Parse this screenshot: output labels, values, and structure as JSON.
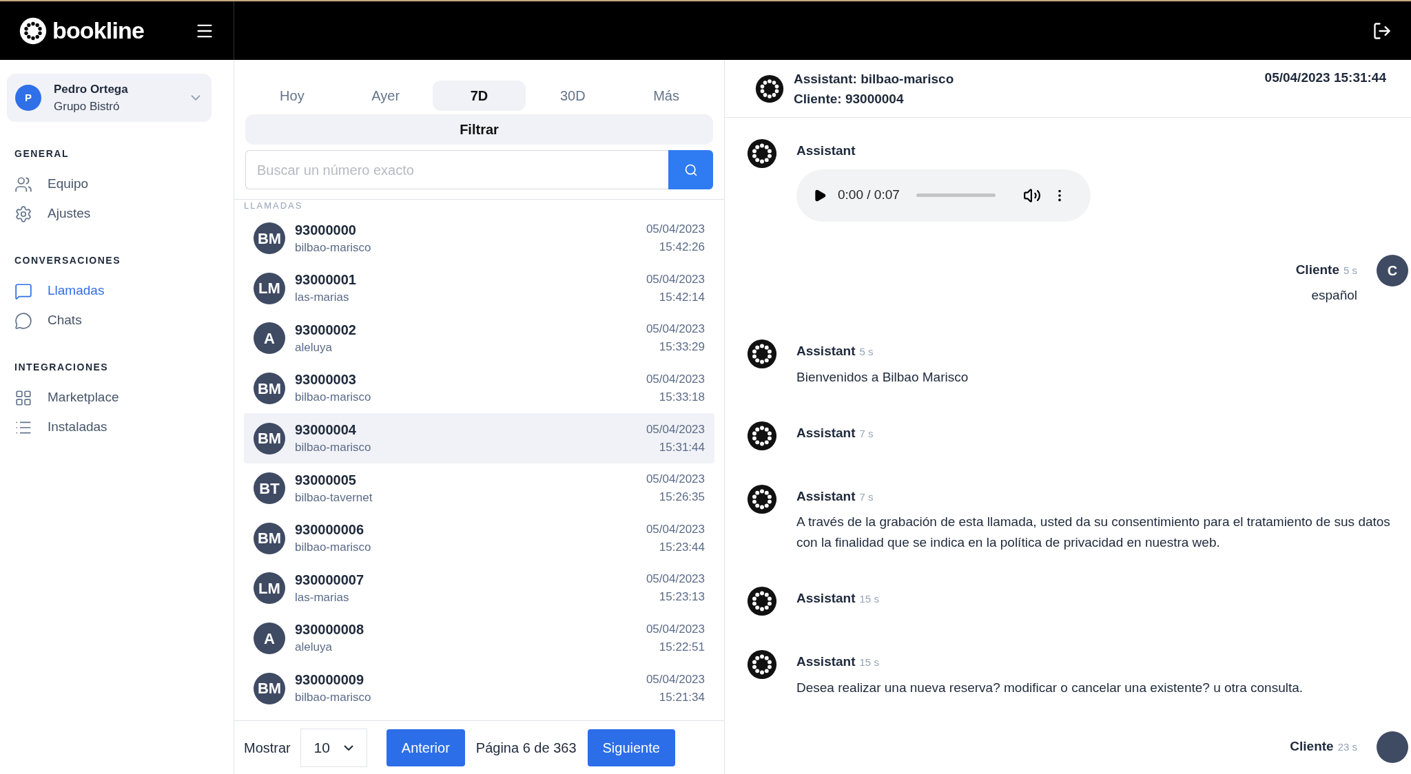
{
  "header": {
    "logo_text": "bookline"
  },
  "profile": {
    "initial": "P",
    "name": "Pedro Ortega",
    "org": "Grupo Bistró"
  },
  "nav_sections": [
    {
      "title": "GENERAL",
      "items": [
        {
          "label": "Equipo",
          "selected": false
        },
        {
          "label": "Ajustes",
          "selected": false
        }
      ]
    },
    {
      "title": "CONVERSACIONES",
      "items": [
        {
          "label": "Llamadas",
          "selected": true
        },
        {
          "label": "Chats",
          "selected": false
        }
      ]
    },
    {
      "title": "INTEGRACIONES",
      "items": [
        {
          "label": "Marketplace",
          "selected": false
        },
        {
          "label": "Instaladas",
          "selected": false
        }
      ]
    }
  ],
  "period_tabs": [
    {
      "label": "Hoy",
      "selected": false
    },
    {
      "label": "Ayer",
      "selected": false
    },
    {
      "label": "7D",
      "selected": true
    },
    {
      "label": "30D",
      "selected": false
    },
    {
      "label": "Más",
      "selected": false
    }
  ],
  "filter_button": "Filtrar",
  "search": {
    "placeholder": "Buscar un número exacto"
  },
  "list_heading": "LLAMADAS",
  "calls": [
    {
      "initials": "BM",
      "number": "93000000",
      "assistant": "bilbao-marisco",
      "date": "05/04/2023",
      "time": "15:42:26",
      "selected": false
    },
    {
      "initials": "LM",
      "number": "93000001",
      "assistant": "las-marias",
      "date": "05/04/2023",
      "time": "15:42:14",
      "selected": false
    },
    {
      "initials": "A",
      "number": "93000002",
      "assistant": "aleluya",
      "date": "05/04/2023",
      "time": "15:33:29",
      "selected": false
    },
    {
      "initials": "BM",
      "number": "93000003",
      "assistant": "bilbao-marisco",
      "date": "05/04/2023",
      "time": "15:33:18",
      "selected": false
    },
    {
      "initials": "BM",
      "number": "93000004",
      "assistant": "bilbao-marisco",
      "date": "05/04/2023",
      "time": "15:31:44",
      "selected": true
    },
    {
      "initials": "BT",
      "number": "93000005",
      "assistant": "bilbao-tavernet",
      "date": "05/04/2023",
      "time": "15:26:35",
      "selected": false
    },
    {
      "initials": "BM",
      "number": "930000006",
      "assistant": "bilbao-marisco",
      "date": "05/04/2023",
      "time": "15:23:44",
      "selected": false
    },
    {
      "initials": "LM",
      "number": "930000007",
      "assistant": "las-marias",
      "date": "05/04/2023",
      "time": "15:23:13",
      "selected": false
    },
    {
      "initials": "A",
      "number": "930000008",
      "assistant": "aleluya",
      "date": "05/04/2023",
      "time": "15:22:51",
      "selected": false
    },
    {
      "initials": "BM",
      "number": "930000009",
      "assistant": "bilbao-marisco",
      "date": "05/04/2023",
      "time": "15:21:34",
      "selected": false
    }
  ],
  "pagination": {
    "show_label": "Mostrar",
    "page_size": "10",
    "prev": "Anterior",
    "page_text": "Página 6 de 363",
    "next": "Siguiente"
  },
  "conversation": {
    "assistant_line": "Assistant: bilbao-marisco",
    "client_line": "Cliente: 93000004",
    "datetime": "05/04/2023 15:31:44",
    "messages": [
      {
        "kind": "assistant",
        "name": "Assistant",
        "audio": {
          "time": "0:00 / 0:07"
        }
      },
      {
        "kind": "client",
        "name": "Cliente",
        "elapsed": "5 s",
        "initial": "C",
        "text": "español"
      },
      {
        "kind": "assistant",
        "name": "Assistant",
        "elapsed": "5 s",
        "text": "Bienvenidos a Bilbao Marisco"
      },
      {
        "kind": "assistant",
        "name": "Assistant",
        "elapsed": "7 s"
      },
      {
        "kind": "assistant",
        "name": "Assistant",
        "elapsed": "7 s",
        "text": "A través de la grabación de esta llamada, usted da su consentimiento para el tratamiento de sus datos con la finalidad que se indica en la política de privacidad en nuestra web."
      },
      {
        "kind": "assistant",
        "name": "Assistant",
        "elapsed": "15 s"
      },
      {
        "kind": "assistant",
        "name": "Assistant",
        "elapsed": "15 s",
        "text": "Desea realizar una nueva reserva? modificar o cancelar una existente? u otra consulta."
      },
      {
        "kind": "client",
        "name": "Cliente",
        "elapsed": "23 s"
      }
    ]
  }
}
